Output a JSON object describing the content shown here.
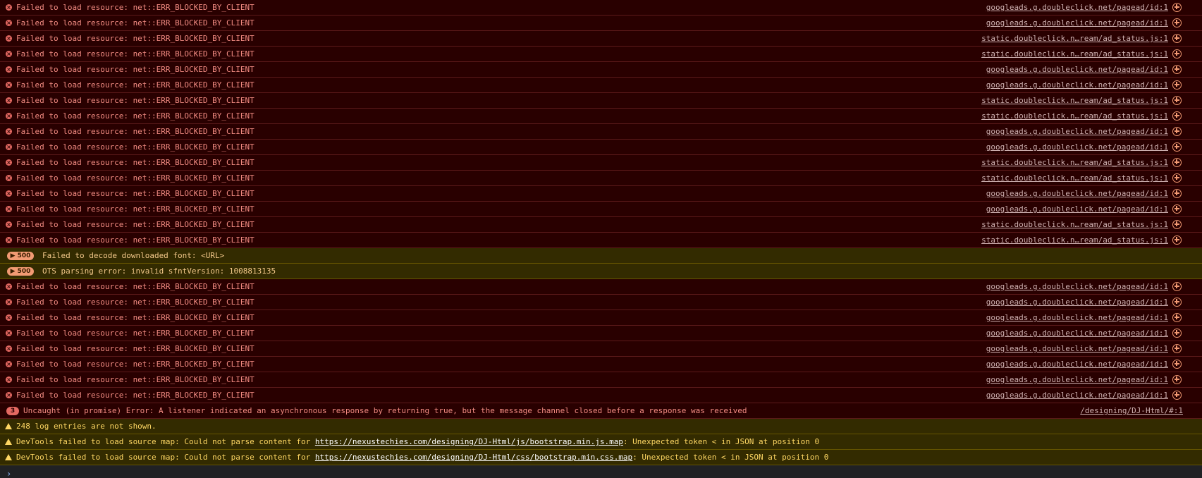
{
  "rows": [
    {
      "kind": "err",
      "text": "Failed to load resource: net::ERR_BLOCKED_BY_CLIENT",
      "source": "googleads.g.doubleclick.net/pagead/id:1"
    },
    {
      "kind": "err",
      "text": "Failed to load resource: net::ERR_BLOCKED_BY_CLIENT",
      "source": "googleads.g.doubleclick.net/pagead/id:1"
    },
    {
      "kind": "err",
      "text": "Failed to load resource: net::ERR_BLOCKED_BY_CLIENT",
      "source": "static.doubleclick.n…ream/ad_status.js:1"
    },
    {
      "kind": "err",
      "text": "Failed to load resource: net::ERR_BLOCKED_BY_CLIENT",
      "source": "static.doubleclick.n…ream/ad_status.js:1"
    },
    {
      "kind": "err",
      "text": "Failed to load resource: net::ERR_BLOCKED_BY_CLIENT",
      "source": "googleads.g.doubleclick.net/pagead/id:1"
    },
    {
      "kind": "err",
      "text": "Failed to load resource: net::ERR_BLOCKED_BY_CLIENT",
      "source": "googleads.g.doubleclick.net/pagead/id:1"
    },
    {
      "kind": "err",
      "text": "Failed to load resource: net::ERR_BLOCKED_BY_CLIENT",
      "source": "static.doubleclick.n…ream/ad_status.js:1"
    },
    {
      "kind": "err",
      "text": "Failed to load resource: net::ERR_BLOCKED_BY_CLIENT",
      "source": "static.doubleclick.n…ream/ad_status.js:1"
    },
    {
      "kind": "err",
      "text": "Failed to load resource: net::ERR_BLOCKED_BY_CLIENT",
      "source": "googleads.g.doubleclick.net/pagead/id:1"
    },
    {
      "kind": "err",
      "text": "Failed to load resource: net::ERR_BLOCKED_BY_CLIENT",
      "source": "googleads.g.doubleclick.net/pagead/id:1"
    },
    {
      "kind": "err",
      "text": "Failed to load resource: net::ERR_BLOCKED_BY_CLIENT",
      "source": "static.doubleclick.n…ream/ad_status.js:1"
    },
    {
      "kind": "err",
      "text": "Failed to load resource: net::ERR_BLOCKED_BY_CLIENT",
      "source": "static.doubleclick.n…ream/ad_status.js:1"
    },
    {
      "kind": "err",
      "text": "Failed to load resource: net::ERR_BLOCKED_BY_CLIENT",
      "source": "googleads.g.doubleclick.net/pagead/id:1"
    },
    {
      "kind": "err",
      "text": "Failed to load resource: net::ERR_BLOCKED_BY_CLIENT",
      "source": "googleads.g.doubleclick.net/pagead/id:1"
    },
    {
      "kind": "err",
      "text": "Failed to load resource: net::ERR_BLOCKED_BY_CLIENT",
      "source": "static.doubleclick.n…ream/ad_status.js:1"
    },
    {
      "kind": "err",
      "text": "Failed to load resource: net::ERR_BLOCKED_BY_CLIENT",
      "source": "static.doubleclick.n…ream/ad_status.js:1"
    },
    {
      "kind": "group",
      "badge": "▶ 500",
      "text": "Failed to decode downloaded font: <URL>"
    },
    {
      "kind": "group",
      "badge": "▶ 500",
      "text": "OTS parsing error: invalid sfntVersion: 1008813135"
    },
    {
      "kind": "err",
      "text": "Failed to load resource: net::ERR_BLOCKED_BY_CLIENT",
      "source": "googleads.g.doubleclick.net/pagead/id:1"
    },
    {
      "kind": "err",
      "text": "Failed to load resource: net::ERR_BLOCKED_BY_CLIENT",
      "source": "googleads.g.doubleclick.net/pagead/id:1"
    },
    {
      "kind": "err",
      "text": "Failed to load resource: net::ERR_BLOCKED_BY_CLIENT",
      "source": "googleads.g.doubleclick.net/pagead/id:1"
    },
    {
      "kind": "err",
      "text": "Failed to load resource: net::ERR_BLOCKED_BY_CLIENT",
      "source": "googleads.g.doubleclick.net/pagead/id:1"
    },
    {
      "kind": "err",
      "text": "Failed to load resource: net::ERR_BLOCKED_BY_CLIENT",
      "source": "googleads.g.doubleclick.net/pagead/id:1"
    },
    {
      "kind": "err",
      "text": "Failed to load resource: net::ERR_BLOCKED_BY_CLIENT",
      "source": "googleads.g.doubleclick.net/pagead/id:1"
    },
    {
      "kind": "err",
      "text": "Failed to load resource: net::ERR_BLOCKED_BY_CLIENT",
      "source": "googleads.g.doubleclick.net/pagead/id:1"
    },
    {
      "kind": "err",
      "text": "Failed to load resource: net::ERR_BLOCKED_BY_CLIENT",
      "source": "googleads.g.doubleclick.net/pagead/id:1"
    },
    {
      "kind": "counted-err",
      "count": "3",
      "text": "Uncaught (in promise) Error: A listener indicated an asynchronous response by returning true, but the message channel closed before a response was received",
      "source": "/designing/DJ-Html/#:1"
    },
    {
      "kind": "warn",
      "text": "248 log entries are not shown."
    },
    {
      "kind": "warn-link",
      "prefix": "DevTools failed to load source map: Could not parse content for ",
      "link": "https://nexustechies.com/designing/DJ-Html/js/bootstrap.min.js.map",
      "suffix": ": Unexpected token < in JSON at position 0"
    },
    {
      "kind": "warn-link",
      "prefix": "DevTools failed to load source map: Could not parse content for ",
      "link": "https://nexustechies.com/designing/DJ-Html/css/bootstrap.min.css.map",
      "suffix": ": Unexpected token < in JSON at position 0"
    }
  ],
  "icons": {
    "error": "error-icon",
    "warning": "warning-icon",
    "source_action": "source-action-icon",
    "prompt": "prompt-chevron-icon"
  },
  "prompt": {
    "glyph": "›"
  },
  "colors": {
    "error_bg": "#290000",
    "error_text": "#f28b82",
    "warn_bg": "#332b00",
    "warn_text": "#fdd663",
    "prompt_bg": "#202124"
  }
}
